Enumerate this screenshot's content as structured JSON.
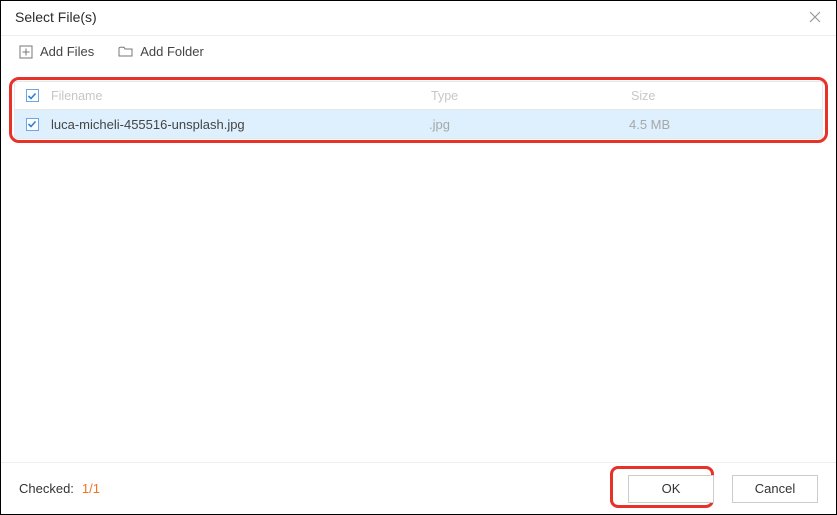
{
  "titlebar": {
    "title": "Select File(s)"
  },
  "toolbar": {
    "add_files_label": "Add Files",
    "add_folder_label": "Add Folder"
  },
  "table": {
    "headers": {
      "filename": "Filename",
      "type": "Type",
      "size": "Size"
    },
    "row": {
      "name": "luca-micheli-455516-unsplash.jpg",
      "type": ".jpg",
      "size": "4.5 MB"
    }
  },
  "footer": {
    "checked_label": "Checked:",
    "count_text": "1/1",
    "ok_label": "OK",
    "cancel_label": "Cancel"
  }
}
